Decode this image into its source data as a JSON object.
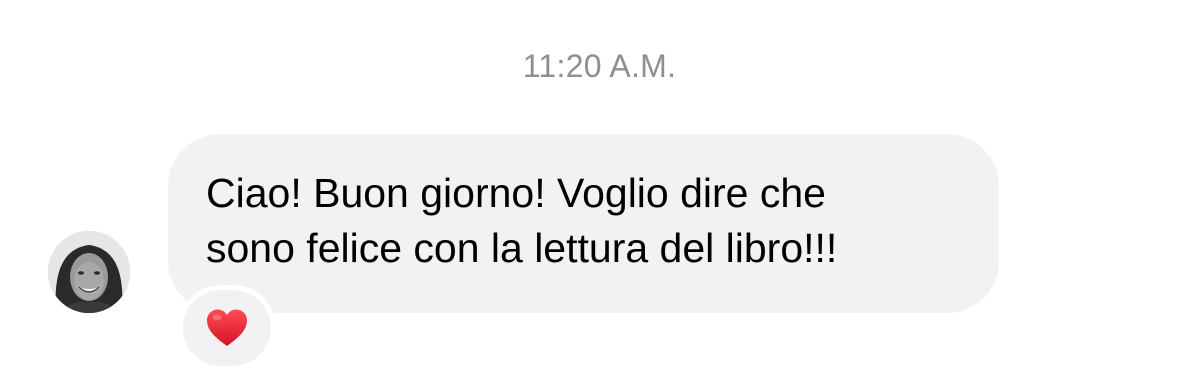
{
  "timestamp": "11:20 A.M.",
  "message": {
    "sender_avatar_icon": "avatar-photo",
    "text": "Ciao! Buon giorno! Voglio dire che\nsono felice con la lettura del libro!!!",
    "bubble_color": "#f2f2f4",
    "reaction": {
      "icon": "heart-icon",
      "color": "#e02030"
    }
  }
}
